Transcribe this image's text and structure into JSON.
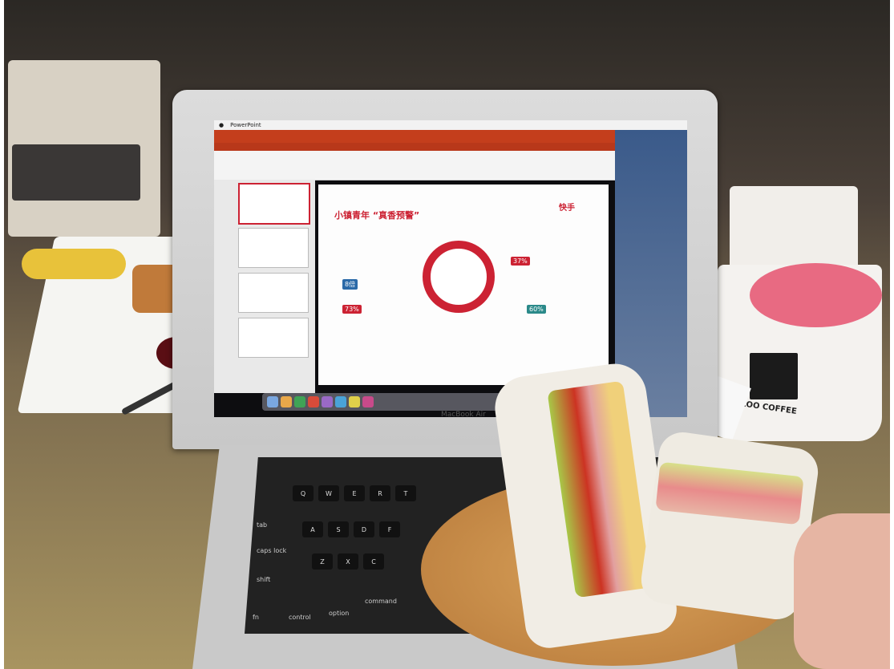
{
  "laptop": {
    "menubar": [
      "PowerPoint"
    ],
    "brand": "MacBook Air",
    "slide": {
      "title": "小镇青年 “真香预警”",
      "brand": "快手",
      "badges": [
        "37%",
        "8倍",
        "73%",
        "60%"
      ]
    }
  },
  "keyboard": {
    "labels": [
      "tab",
      "caps lock",
      "shift",
      "fn",
      "control",
      "option",
      "command"
    ],
    "keys": [
      "Q",
      "W",
      "E",
      "R",
      "T",
      "A",
      "S",
      "D",
      "F",
      "Z",
      "X",
      "C"
    ]
  },
  "mug": {
    "logo_text": "ZOO COFFEE"
  }
}
